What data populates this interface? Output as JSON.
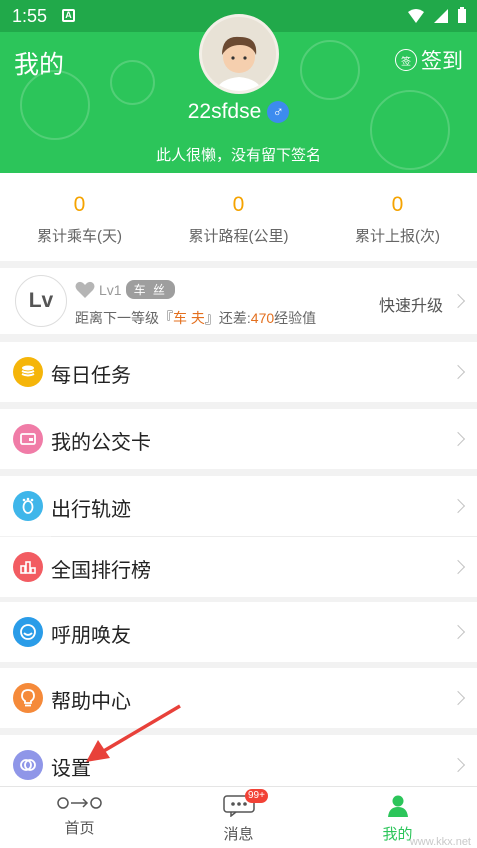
{
  "status_bar": {
    "time": "1:55",
    "notif_letter": "A"
  },
  "header": {
    "title": "我的",
    "signin_badge": "签",
    "signin_label": "签到",
    "username": "22sfdse",
    "gender_symbol": "♂",
    "signature": "此人很懒，没有留下签名"
  },
  "stats": [
    {
      "value": "0",
      "label": "累计乘车(天)"
    },
    {
      "value": "0",
      "label": "累计路程(公里)"
    },
    {
      "value": "0",
      "label": "累计上报(次)"
    }
  ],
  "level": {
    "circle_text": "Lv",
    "level_label": "Lv1",
    "badge": "车 丝",
    "next_prefix": "距离下一等级『",
    "next_level": "车  夫",
    "next_mid": "』还差:",
    "points_needed": "470",
    "points_unit": "经验值",
    "action": "快速升级"
  },
  "menu": [
    {
      "label": "每日任务",
      "icon": "coins-icon",
      "color": "#f5b50a"
    },
    {
      "label": "我的公交卡",
      "icon": "bus-card-icon",
      "color": "#f07ca7"
    },
    {
      "label": "出行轨迹",
      "icon": "footprint-icon",
      "color": "#3fb6ea"
    },
    {
      "label": "全国排行榜",
      "icon": "ranking-icon",
      "color": "#f25c62"
    },
    {
      "label": "呼朋唤友",
      "icon": "smile-icon",
      "color": "#2a9ce8"
    },
    {
      "label": "帮助中心",
      "icon": "lightbulb-icon",
      "color": "#f58a3a"
    },
    {
      "label": "设置",
      "icon": "settings-rings-icon",
      "color": "#8f96e8"
    }
  ],
  "tabs": [
    {
      "label": "首页",
      "icon": "route-icon"
    },
    {
      "label": "消息",
      "icon": "message-icon",
      "badge": "99+"
    },
    {
      "label": "我的",
      "icon": "person-icon"
    }
  ],
  "colors": {
    "accent": "#2cc55a",
    "orange": "#f5a300",
    "badge_red": "#f24236"
  },
  "watermark": "www.kkx.net"
}
